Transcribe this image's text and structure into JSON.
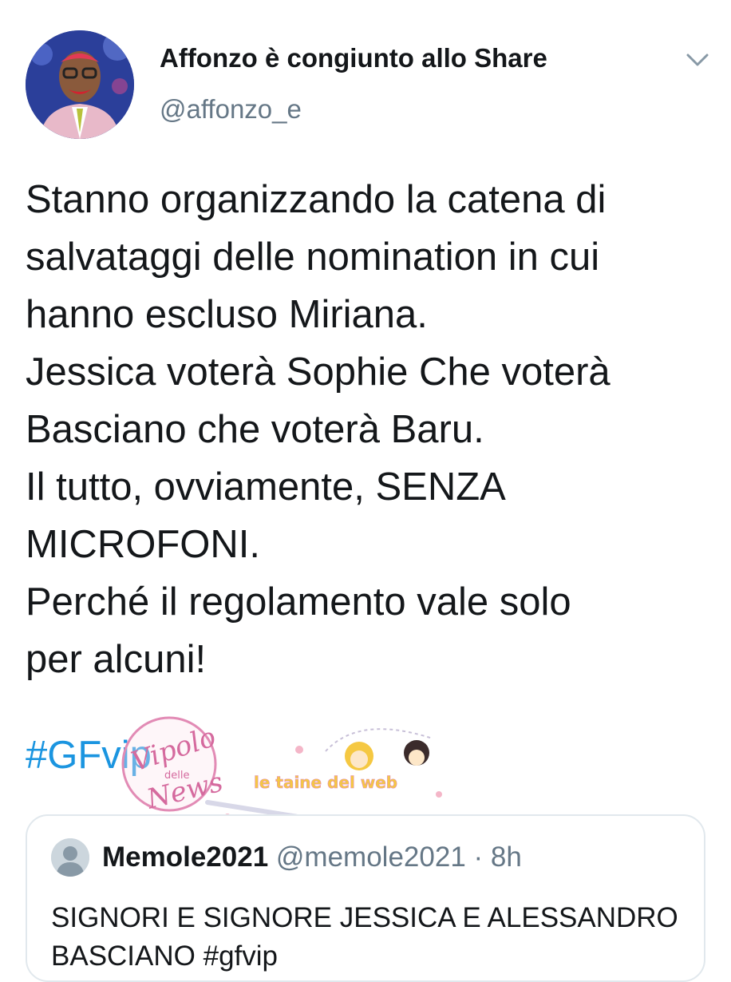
{
  "tweet": {
    "author": {
      "display_name": "Affonzo è congiunto allo Share",
      "handle": "@affonzo_e"
    },
    "body_lines": [
      "Stanno organizzando la catena di",
      "salvataggi delle nomination in cui",
      "hanno escluso Miriana.",
      "Jessica voterà Sophie Che voterà",
      "Basciano che voterà Baru.",
      "Il tutto, ovviamente, SENZA",
      "MICROFONI.",
      "Perché il regolamento vale solo",
      "per alcuni!"
    ],
    "hashtag": "#GFvip"
  },
  "watermark": {
    "brand_line1": "Vipolo",
    "brand_small": "delle",
    "brand_line2": "News",
    "tagline": "le taine del web"
  },
  "quoted_tweet": {
    "display_name": "Memole2021",
    "handle": "@memole2021",
    "separator": "·",
    "time": "8h",
    "text_line1": "SIGNORI E SIGNORE JESSICA E ALESSANDRO",
    "text_line2": "BASCIANO",
    "hashtag": "#gfvip"
  },
  "colors": {
    "primary_text": "#14171a",
    "secondary_text": "#657786",
    "link": "#1b95e0",
    "border": "#e1e8ed",
    "watermark_pink": "#e28bb5"
  },
  "icons": {
    "menu": "chevron-down-icon",
    "quoted_avatar": "default-avatar-icon"
  }
}
